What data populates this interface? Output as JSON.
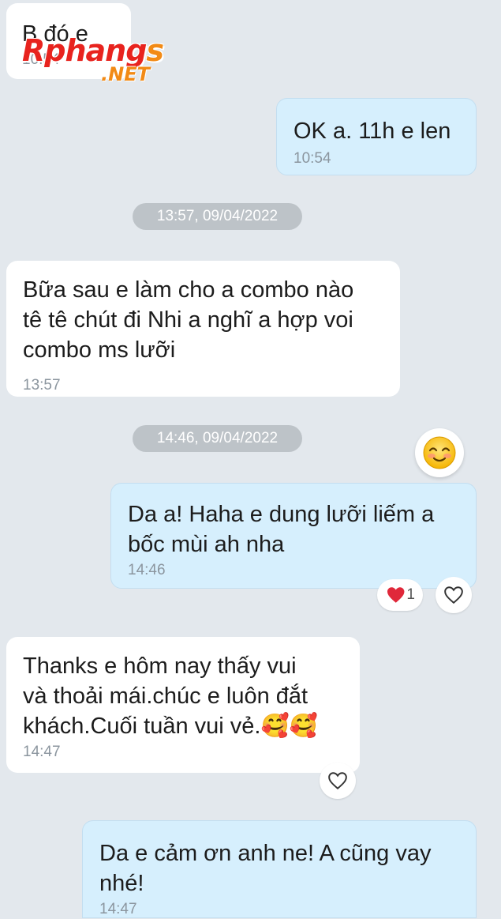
{
  "watermark": {
    "brand_main": "Rphang",
    "brand_accent": "s",
    "brand_sub": ".NET"
  },
  "messages": [
    {
      "direction": "incoming",
      "text": "B đó e",
      "time": "10:54"
    },
    {
      "direction": "outgoing",
      "text": "OK a. 11h e len",
      "time": "10:54"
    },
    {
      "direction": "incoming",
      "text": "Bữa sau e làm cho a combo nào\ntê tê chút đi Nhi a nghĩ a hợp voi\ncombo ms lưỡi",
      "time": "13:57"
    },
    {
      "direction": "outgoing",
      "text": "Da a! Haha e dung lưỡi liếm a\nbốc mùi ah nha",
      "time": "14:46",
      "reaction": {
        "icon": "red-heart-icon",
        "count": "1"
      }
    },
    {
      "direction": "incoming",
      "text": "Thanks e hôm nay thấy vui\nvà thoải mái.chúc e luôn đắt\nkhách.Cuối tuần vui vẻ.🥰🥰",
      "time": "14:47"
    },
    {
      "direction": "outgoing",
      "text": "Da e cảm ơn anh ne! A cũng vay\nnhé!",
      "time": "14:47"
    }
  ],
  "date_separators": [
    {
      "label": "13:57, 09/04/2022"
    },
    {
      "label": "14:46, 09/04/2022"
    }
  ],
  "sticker": {
    "icon": "smiling-face-icon"
  },
  "colors": {
    "background": "#e3e8ed",
    "incoming_bubble": "#ffffff",
    "outgoing_bubble": "#d6effd",
    "timestamp": "#8b959e",
    "date_pill": "#bdc3c8",
    "heart": "#e0283a"
  }
}
